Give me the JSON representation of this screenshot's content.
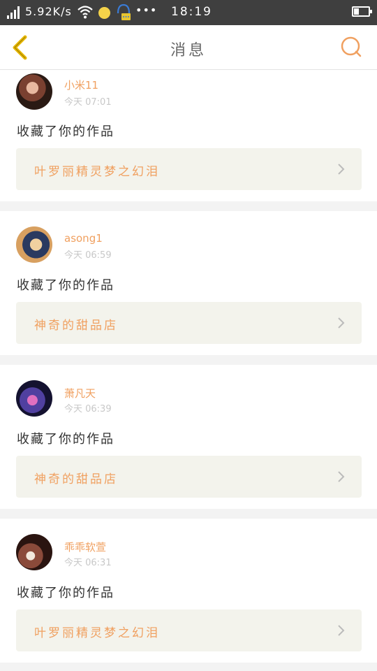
{
  "statusbar": {
    "speed": "5.92K/s",
    "time": "18:19",
    "more": "•••"
  },
  "header": {
    "title": "消息"
  },
  "colors": {
    "accent": "#f0a060",
    "back_arrow": "#e8b800",
    "card_bg": "#f3f3ec"
  },
  "notifications": [
    {
      "user": "小米11",
      "time": "今天 07:01",
      "action": "收藏了你的作品",
      "work": "叶罗丽精灵梦之幻泪"
    },
    {
      "user": "asong1",
      "time": "今天 06:59",
      "action": "收藏了你的作品",
      "work": "神奇的甜品店"
    },
    {
      "user": "萧凡天",
      "time": "今天 06:39",
      "action": "收藏了你的作品",
      "work": "神奇的甜品店"
    },
    {
      "user": "乖乖软萱",
      "time": "今天 06:31",
      "action": "收藏了你的作品",
      "work": "叶罗丽精灵梦之幻泪"
    }
  ]
}
